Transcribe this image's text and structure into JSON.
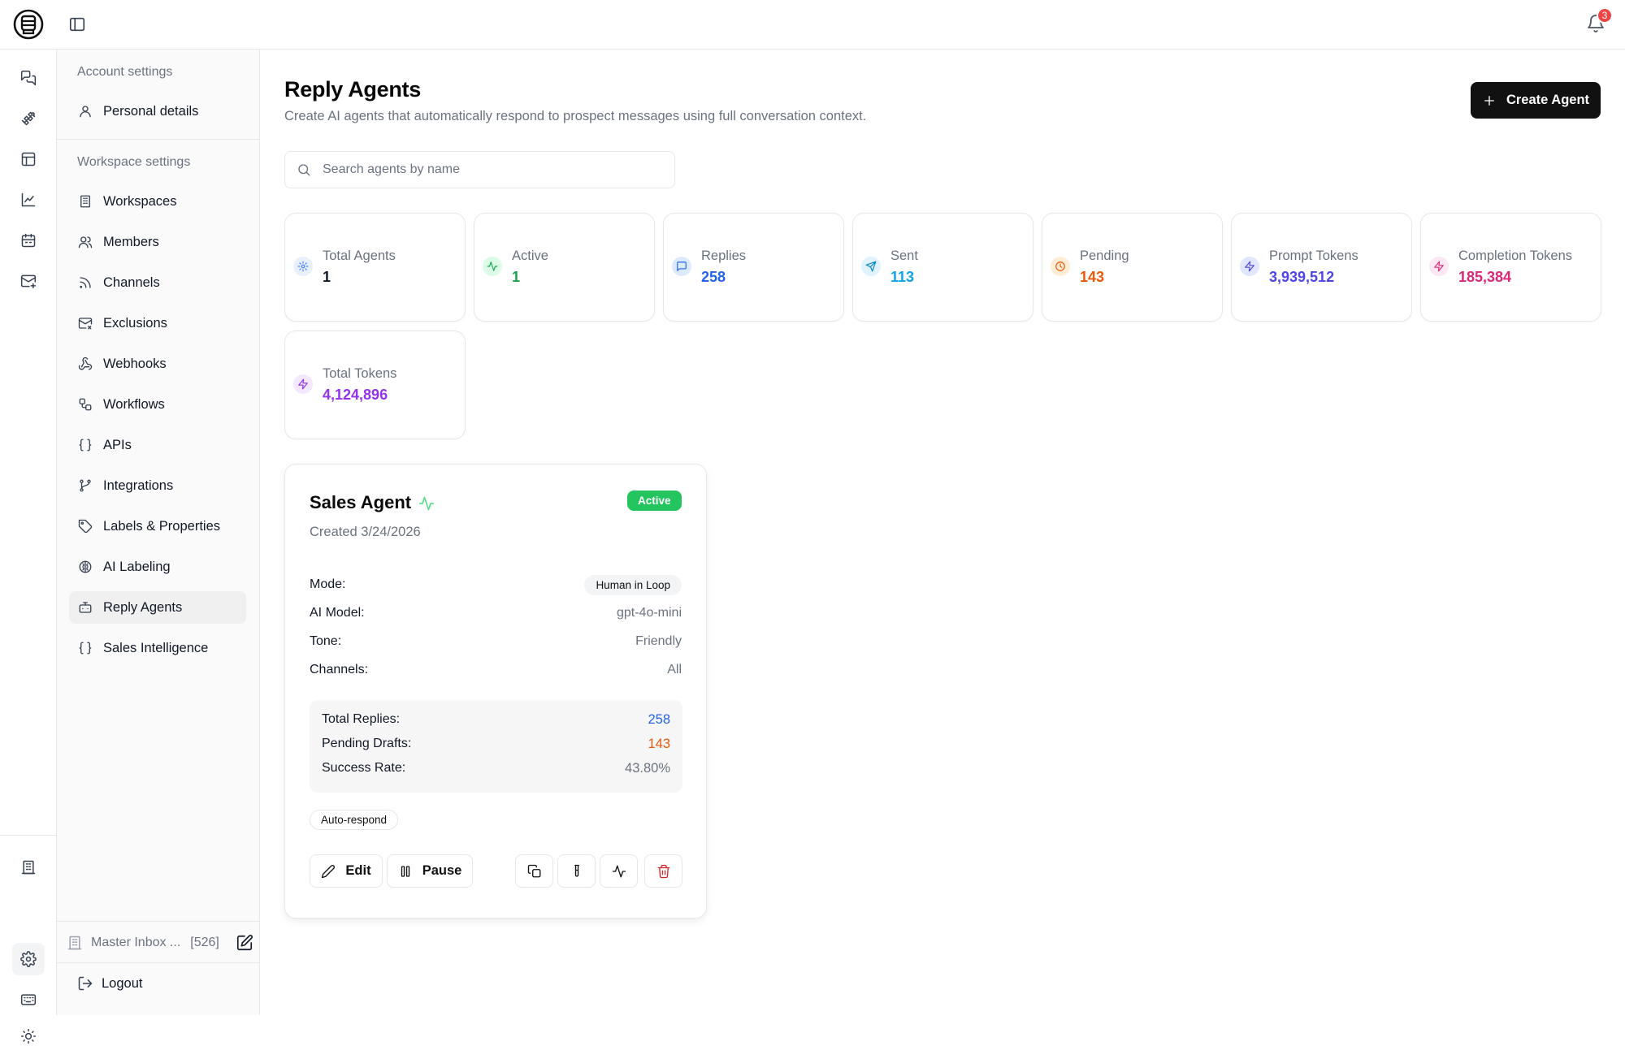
{
  "app": {
    "notifications_count": "3"
  },
  "settings_sidebar": {
    "account_section_title": "Account settings",
    "account_items": [
      {
        "label": "Personal details",
        "icon": "user-icon"
      }
    ],
    "workspace_section_title": "Workspace settings",
    "workspace_items": [
      {
        "label": "Workspaces",
        "icon": "building-icon"
      },
      {
        "label": "Members",
        "icon": "users-icon"
      },
      {
        "label": "Channels",
        "icon": "rss-icon"
      },
      {
        "label": "Exclusions",
        "icon": "mail-x-icon"
      },
      {
        "label": "Webhooks",
        "icon": "webhook-icon"
      },
      {
        "label": "Workflows",
        "icon": "workflow-icon"
      },
      {
        "label": "APIs",
        "icon": "braces-icon"
      },
      {
        "label": "Integrations",
        "icon": "git-branch-icon"
      },
      {
        "label": "Labels & Properties",
        "icon": "tag-icon"
      },
      {
        "label": "AI Labeling",
        "icon": "brain-icon"
      },
      {
        "label": "Reply Agents",
        "icon": "bot-icon",
        "active": true
      },
      {
        "label": "Sales Intelligence",
        "icon": "braces-icon"
      }
    ],
    "master_inbox_label": "Master Inbox ...",
    "master_inbox_count": "[526]",
    "logout_label": "Logout"
  },
  "header": {
    "title": "Reply Agents",
    "subtitle": "Create AI agents that automatically respond to prospect messages using full conversation context.",
    "create_button_label": "Create Agent"
  },
  "search": {
    "placeholder": "Search agents by name",
    "value": ""
  },
  "stats": [
    {
      "label": "Total Agents",
      "value": "1",
      "color": "#111827",
      "icon": "gear-icon",
      "icon_bg": "#e8f0fe",
      "icon_color": "#3b82f6"
    },
    {
      "label": "Active",
      "value": "1",
      "color": "#16a34a",
      "icon": "activity-icon",
      "icon_bg": "#dcfce7",
      "icon_color": "#16a34a"
    },
    {
      "label": "Replies",
      "value": "258",
      "color": "#2563eb",
      "icon": "message-square-icon",
      "icon_bg": "#dbeafe",
      "icon_color": "#2563eb"
    },
    {
      "label": "Sent",
      "value": "113",
      "color": "#0ea5e9",
      "icon": "send-icon",
      "icon_bg": "#e0f2fe",
      "icon_color": "#0284c7"
    },
    {
      "label": "Pending",
      "value": "143",
      "color": "#ea580c",
      "icon": "clock-icon",
      "icon_bg": "#ffedd5",
      "icon_color": "#ea580c"
    },
    {
      "label": "Prompt Tokens",
      "value": "3,939,512",
      "color": "#4f46e5",
      "icon": "zap-icon",
      "icon_bg": "#e0e7ff",
      "icon_color": "#4f46e5"
    },
    {
      "label": "Completion Tokens",
      "value": "185,384",
      "color": "#db2777",
      "icon": "zap-icon",
      "icon_bg": "#fce7f3",
      "icon_color": "#db2777"
    },
    {
      "label": "Total Tokens",
      "value": "4,124,896",
      "color": "#9333ea",
      "icon": "zap-icon",
      "icon_bg": "#f3e8ff",
      "icon_color": "#9333ea"
    }
  ],
  "agent": {
    "name": "Sales Agent",
    "status": "Active",
    "created": "Created 3/24/2026",
    "mode_label": "Mode:",
    "mode_value": "Human in Loop",
    "model_label": "AI Model:",
    "model_value": "gpt-4o-mini",
    "tone_label": "Tone:",
    "tone_value": "Friendly",
    "channels_label": "Channels:",
    "channels_value": "All",
    "total_replies_label": "Total Replies:",
    "total_replies_value": "258",
    "pending_drafts_label": "Pending Drafts:",
    "pending_drafts_value": "143",
    "success_rate_label": "Success Rate:",
    "success_rate_value": "43.80%",
    "auto_respond_label": "Auto-respond",
    "edit_label": "Edit",
    "pause_label": "Pause"
  },
  "colors": {
    "accent_dark": "#111111",
    "active_green": "#22c55e",
    "replies_blue": "#2563eb",
    "pending_orange": "#ea580c",
    "delete_red": "#dc2626"
  }
}
